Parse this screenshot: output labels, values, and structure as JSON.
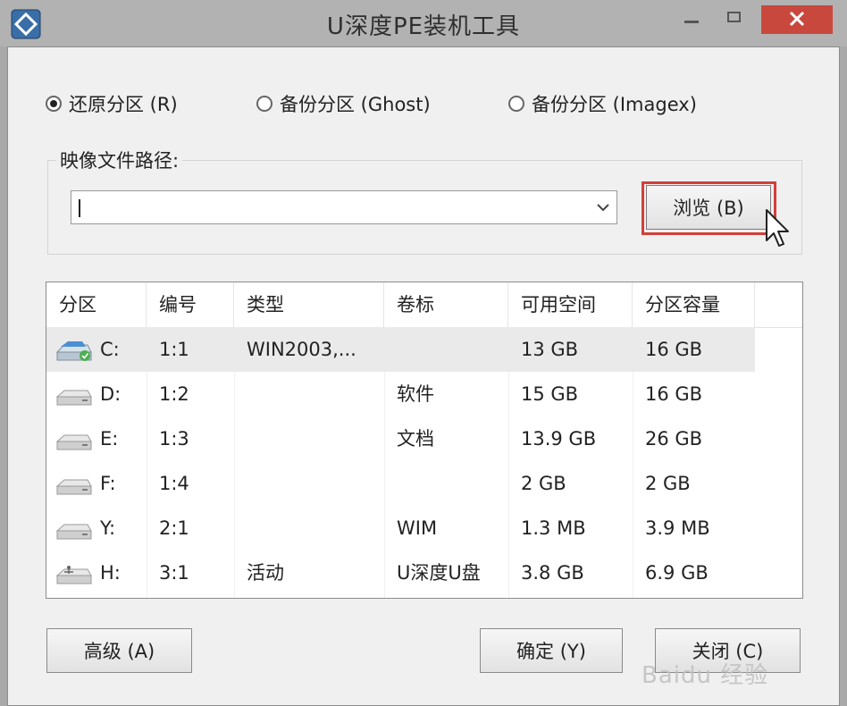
{
  "window": {
    "title": "U深度PE装机工具"
  },
  "mode_options": [
    {
      "label": "还原分区 (R)",
      "selected": true
    },
    {
      "label": "备份分区 (Ghost)",
      "selected": false
    },
    {
      "label": "备份分区 (Imagex)",
      "selected": false
    }
  ],
  "image_path": {
    "label": "映像文件路径:",
    "value": "",
    "browse_label": "浏览 (B)"
  },
  "table": {
    "columns": [
      "分区",
      "编号",
      "类型",
      "卷标",
      "可用空间",
      "分区容量"
    ],
    "rows": [
      {
        "icon": "system-drive-icon",
        "partition": "C:",
        "number": "1:1",
        "type": "WIN2003,...",
        "label": "",
        "free": "13 GB",
        "capacity": "16 GB",
        "selected": true
      },
      {
        "icon": "hard-drive-icon",
        "partition": "D:",
        "number": "1:2",
        "type": "",
        "label": "软件",
        "free": "15 GB",
        "capacity": "16 GB",
        "selected": false
      },
      {
        "icon": "hard-drive-icon",
        "partition": "E:",
        "number": "1:3",
        "type": "",
        "label": "文档",
        "free": "13.9 GB",
        "capacity": "26 GB",
        "selected": false
      },
      {
        "icon": "hard-drive-icon",
        "partition": "F:",
        "number": "1:4",
        "type": "",
        "label": "",
        "free": "2 GB",
        "capacity": "2 GB",
        "selected": false
      },
      {
        "icon": "hard-drive-icon",
        "partition": "Y:",
        "number": "2:1",
        "type": "",
        "label": "WIM",
        "free": "1.3 MB",
        "capacity": "3.9 MB",
        "selected": false
      },
      {
        "icon": "usb-drive-icon",
        "partition": "H:",
        "number": "3:1",
        "type": "活动",
        "label": "U深度U盘",
        "free": "3.8 GB",
        "capacity": "6.9 GB",
        "selected": false
      }
    ]
  },
  "buttons": {
    "advanced": "高级 (A)",
    "ok": "确定 (Y)",
    "close": "关闭 (C)"
  },
  "watermark": "Baidu 经验",
  "colors": {
    "close_button": "#c9483d",
    "highlight_box": "#d2403a"
  }
}
